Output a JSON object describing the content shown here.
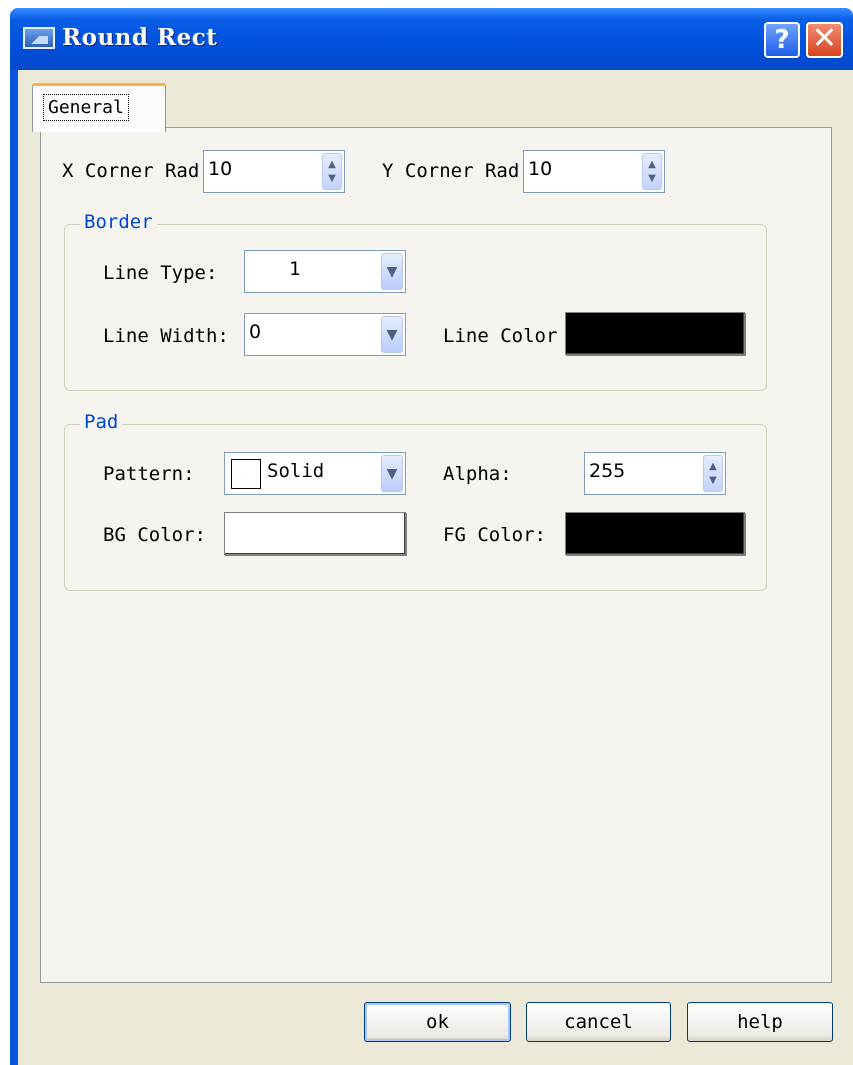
{
  "window": {
    "title": "Round Rect",
    "help_glyph": "?",
    "close_glyph": "✕"
  },
  "tabs": [
    {
      "label": "General"
    }
  ],
  "corner": {
    "x_label": "X Corner Rad",
    "x_value": "10",
    "y_label": "Y Corner Rad",
    "y_value": "10"
  },
  "border": {
    "legend": "Border",
    "line_type_label": "Line Type:",
    "line_type_value": "1",
    "line_width_label": "Line Width:",
    "line_width_value": "0",
    "line_color_label": "Line Color",
    "line_color": "#000000"
  },
  "pad": {
    "legend": "Pad",
    "pattern_label": "Pattern:",
    "pattern_value": "Solid",
    "alpha_label": "Alpha:",
    "alpha_value": "255",
    "bg_color_label": "BG Color:",
    "bg_color": "#ffffff",
    "fg_color_label": "FG Color:",
    "fg_color": "#000000"
  },
  "buttons": {
    "ok": "ok",
    "cancel": "cancel",
    "help": "help"
  },
  "icons": {
    "spin_up": "▲",
    "spin_down": "▼",
    "dropdown": "▼"
  }
}
